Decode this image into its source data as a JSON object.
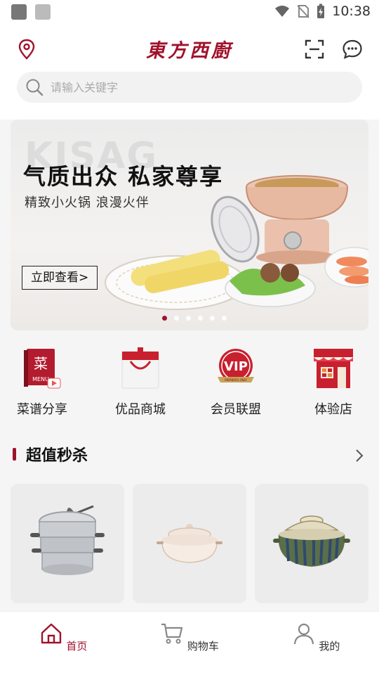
{
  "status_bar": {
    "time": "10:38"
  },
  "header": {
    "logo_text": "東方西廚"
  },
  "search": {
    "placeholder": "请输入关键字"
  },
  "banner": {
    "watermark": "KISAG",
    "title": "气质出众 私家尊享",
    "subtitle": "精致小火锅 浪漫火伴",
    "button_label": "立即查看>",
    "dots_total": 6,
    "active_dot": 0
  },
  "categories": [
    {
      "label": "菜谱分享",
      "icon": "recipe-book-icon"
    },
    {
      "label": "优品商城",
      "icon": "shopping-bag-icon"
    },
    {
      "label": "会员联盟",
      "icon": "vip-badge-icon"
    },
    {
      "label": "体验店",
      "icon": "store-icon"
    }
  ],
  "flash_sale": {
    "title": "超值秒杀",
    "more_icon": "chevron-right-icon"
  },
  "products": [
    {
      "name": "steamer-pot"
    },
    {
      "name": "ceramic-pot"
    },
    {
      "name": "clay-pot"
    }
  ],
  "tabs": [
    {
      "label": "首页",
      "icon": "home-icon",
      "active": true
    },
    {
      "label": "购物车",
      "icon": "cart-icon",
      "active": false
    },
    {
      "label": "我的",
      "icon": "user-icon",
      "active": false
    }
  ],
  "colors": {
    "accent": "#a0122c",
    "inactive": "#888888"
  }
}
